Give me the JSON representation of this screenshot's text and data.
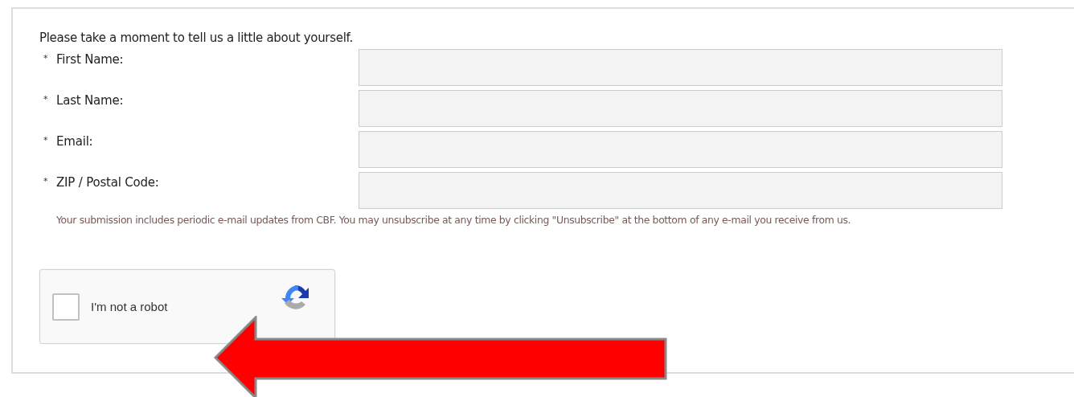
{
  "intro": "Please take a moment to tell us a little about yourself.",
  "fields": [
    {
      "marker": "*",
      "label": "First Name:"
    },
    {
      "marker": "*",
      "label": "Last Name:"
    },
    {
      "marker": "*",
      "label": "Email:"
    },
    {
      "marker": "*",
      "label": "ZIP / Postal Code:"
    }
  ],
  "disclaimer": "Your submission includes periodic e-mail updates from CBF. You may unsubscribe at any time by clicking \"Unsubscribe\" at the bottom of any e-mail you receive from us.",
  "captcha": {
    "label": "I'm not a robot",
    "checked": false
  }
}
